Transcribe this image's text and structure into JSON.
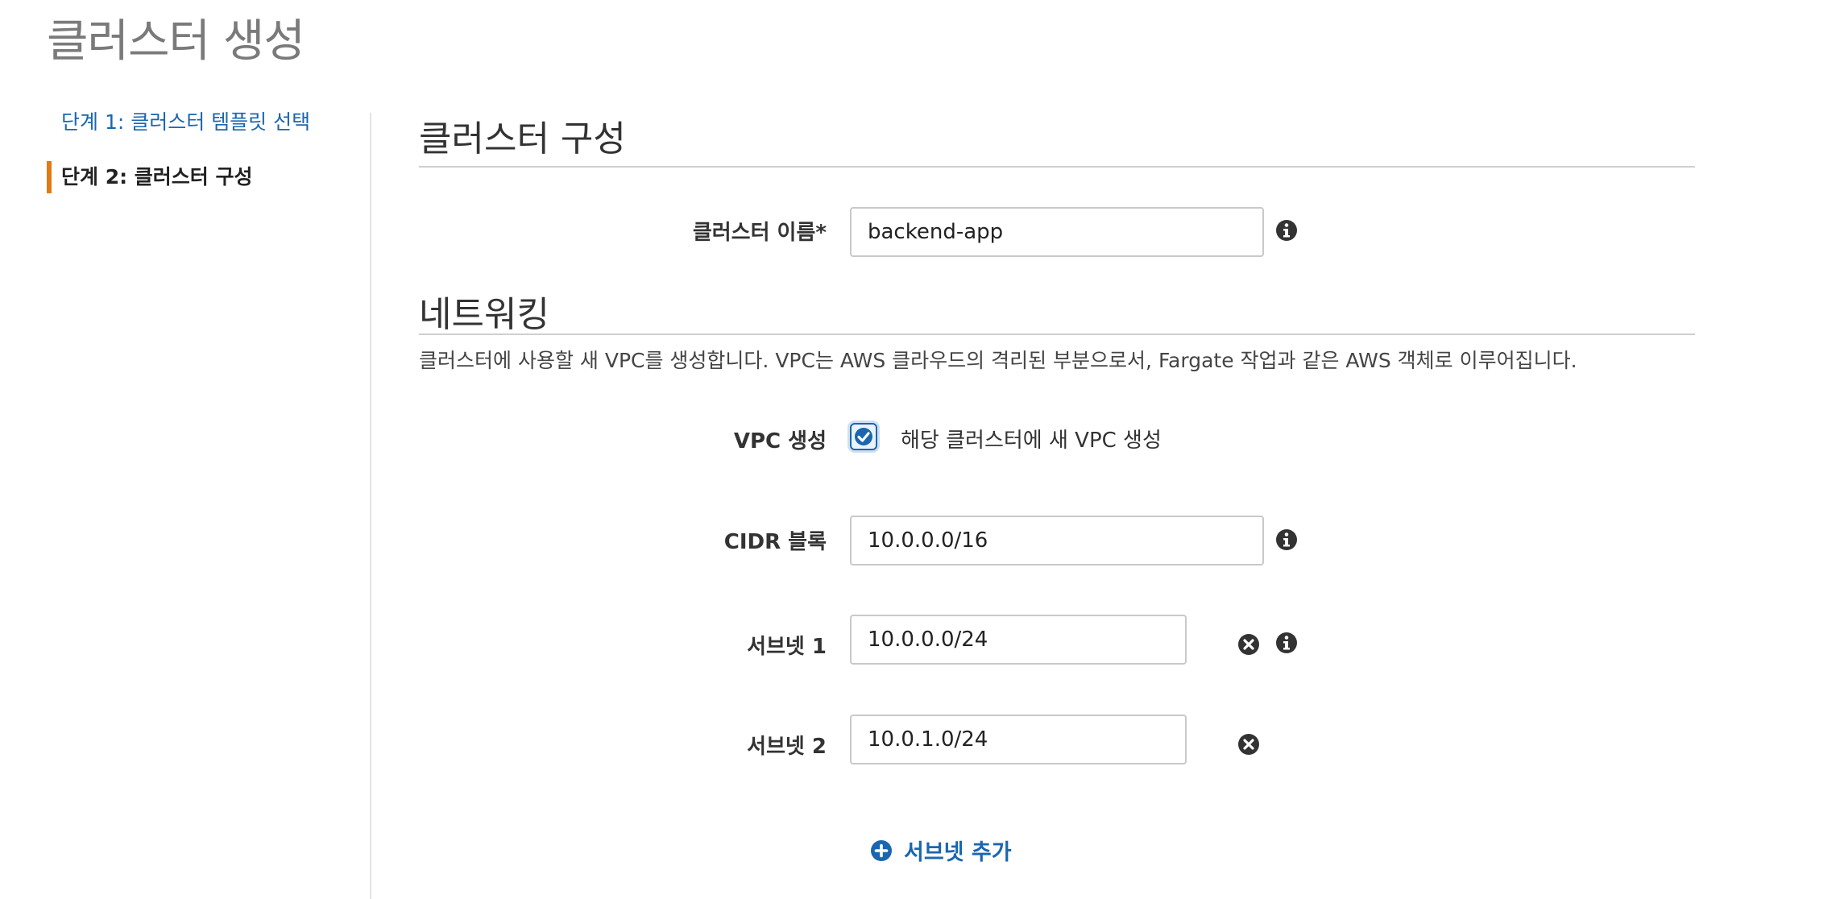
{
  "page": {
    "title": "클러스터 생성"
  },
  "wizard": {
    "step1_label": "단계 1: 클러스터 템플릿 선택",
    "step2_label": "단계 2: 클러스터 구성"
  },
  "cluster_config": {
    "section_title": "클러스터 구성",
    "name_label": "클러스터 이름*",
    "name_value": "backend-app"
  },
  "networking": {
    "section_title": "네트워킹",
    "description": "클러스터에 사용할 새 VPC를 생성합니다. VPC는 AWS 클라우드의 격리된 부분으로서, Fargate 작업과 같은 AWS 객체로 이루어집니다.",
    "vpc_label": "VPC 생성",
    "vpc_checkbox_label": "해당 클러스터에 새 VPC 생성",
    "vpc_checked": true,
    "cidr_label": "CIDR 블록",
    "cidr_value": "10.0.0.0/16",
    "subnets": [
      {
        "label": "서브넷 1",
        "value": "10.0.0.0/24"
      },
      {
        "label": "서브넷 2",
        "value": "10.0.1.0/24"
      }
    ],
    "add_subnet_label": "서브넷 추가"
  },
  "colors": {
    "accent": "#1a66b0",
    "active_step_marker": "#e07b16",
    "icon_dark": "#333333"
  },
  "icons": {
    "info": "info-icon",
    "remove": "remove-icon",
    "add": "plus-circle-icon",
    "check": "checkmark-icon"
  }
}
